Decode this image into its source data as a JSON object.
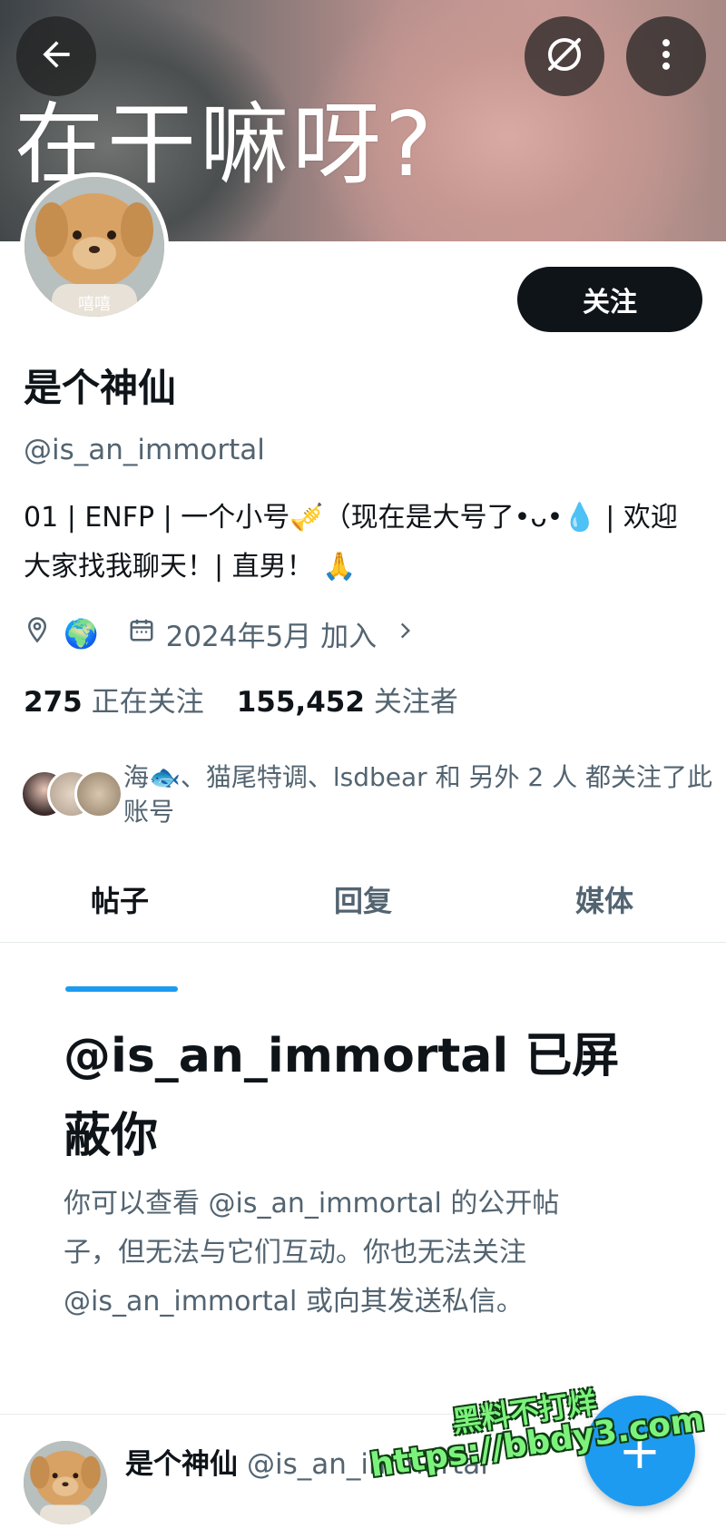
{
  "banner": {
    "text": "在干嘛呀?"
  },
  "profile": {
    "follow_label": "关注",
    "display_name": "是个神仙",
    "handle": "@is_an_immortal",
    "bio": "01 | ENFP | 一个小号🎺（现在是大号了•ᴗ•💧 | 欢迎大家找我聊天！| 直男！ 🙏",
    "location": "🌍",
    "joined": "2024年5月 加入",
    "avatar_text": "嘻嘻"
  },
  "stats": {
    "following_count": "275",
    "following_label": "正在关注",
    "followers_count": "155,452",
    "followers_label": "关注者"
  },
  "followed_by": "海🐟、猫尾特调、lsdbear 和 另外 2 人 都关注了此账号",
  "tabs": [
    "帖子",
    "回复",
    "媒体"
  ],
  "blocked": {
    "title": "@is_an_immortal 已屏蔽你",
    "description": "你可以查看 @is_an_immortal 的公开帖子，但无法与它们互动。你也无法关注 @is_an_immortal 或向其发送私信。"
  },
  "post": {
    "name": "是个神仙",
    "handle": "@is_an_immortal"
  },
  "fab_label": "+",
  "watermark": {
    "line1": "黑料不打烊",
    "line2": "https://bbdy3.com"
  },
  "colors": {
    "accent": "#1d9bf0",
    "text": "#0f1419",
    "secondary": "#536471"
  }
}
